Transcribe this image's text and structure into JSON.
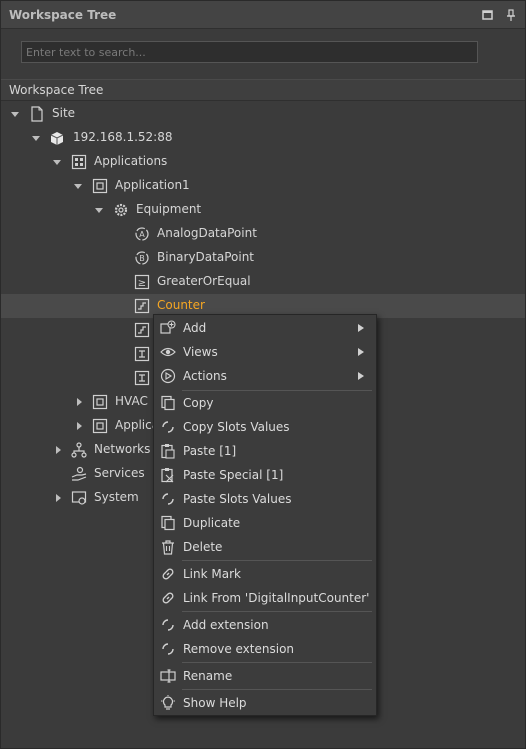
{
  "window": {
    "title": "Workspace Tree"
  },
  "search": {
    "placeholder": "Enter text to search..."
  },
  "section": {
    "title": "Workspace Tree"
  },
  "tree": {
    "site": "Site",
    "ip": "192.168.1.52:88",
    "applications": "Applications",
    "application1": "Application1",
    "equipment": "Equipment",
    "analog": "AnalogDataPoint",
    "binary": "BinaryDataPoint",
    "greater": "GreaterOrEqual",
    "counter": "Counter",
    "hvac": "HVAC",
    "applica": "Applica",
    "networks": "Networks",
    "services": "Services",
    "system": "System"
  },
  "menu": {
    "add": "Add",
    "views": "Views",
    "actions": "Actions",
    "copy": "Copy",
    "copy_slots": "Copy Slots Values",
    "paste": "Paste [1]",
    "paste_special": "Paste Special [1]",
    "paste_slots": "Paste Slots Values",
    "duplicate": "Duplicate",
    "delete": "Delete",
    "link_mark": "Link Mark",
    "link_from": "Link From 'DigitalInputCounter'",
    "add_ext": "Add extension",
    "remove_ext": "Remove extension",
    "rename": "Rename",
    "show_help": "Show Help"
  },
  "colors": {
    "selected_text": "#f5a623",
    "background": "#3b3b3b",
    "menu_bg": "#3c3c3c"
  }
}
